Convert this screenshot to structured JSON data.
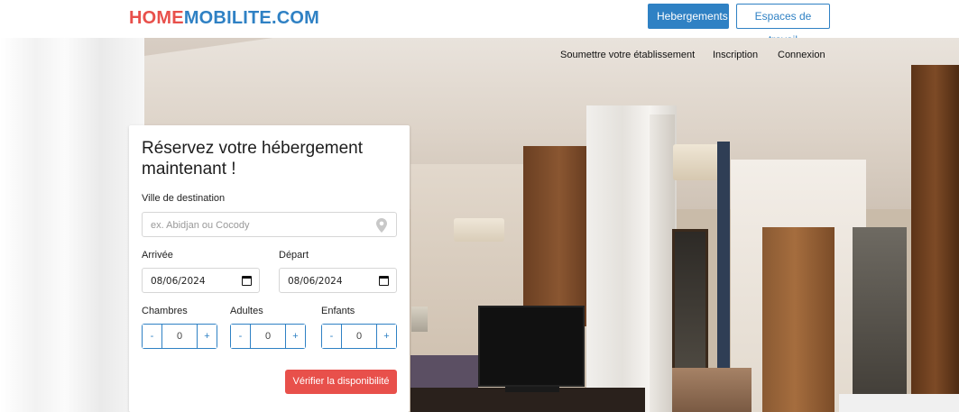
{
  "header": {
    "logo_part1": "HOME",
    "logo_part2": "MOBILITE.COM",
    "btn_hebergements": "Hebergements",
    "btn_espaces": "Espaces de travail"
  },
  "nav": {
    "items": [
      {
        "label": "Soumettre votre établissement"
      },
      {
        "label": "Inscription"
      },
      {
        "label": "Connexion"
      }
    ]
  },
  "booking": {
    "title": "Réservez votre hébergement maintenant !",
    "destination_label": "Ville de destination",
    "destination_placeholder": "ex. Abidjan ou Cocody",
    "arrival_label": "Arrivée",
    "arrival_value": "08/06/2024",
    "departure_label": "Départ",
    "departure_value": "08/06/2024",
    "rooms_label": "Chambres",
    "rooms_value": "0",
    "adults_label": "Adultes",
    "adults_value": "0",
    "children_label": "Enfants",
    "children_value": "0",
    "minus": "-",
    "plus": "+",
    "submit_label": "Vérifier la disponibilité"
  },
  "colors": {
    "brand_red": "#e8504b",
    "brand_blue": "#2f81c4"
  },
  "icons": [
    "map-pin-icon",
    "calendar-icon"
  ]
}
